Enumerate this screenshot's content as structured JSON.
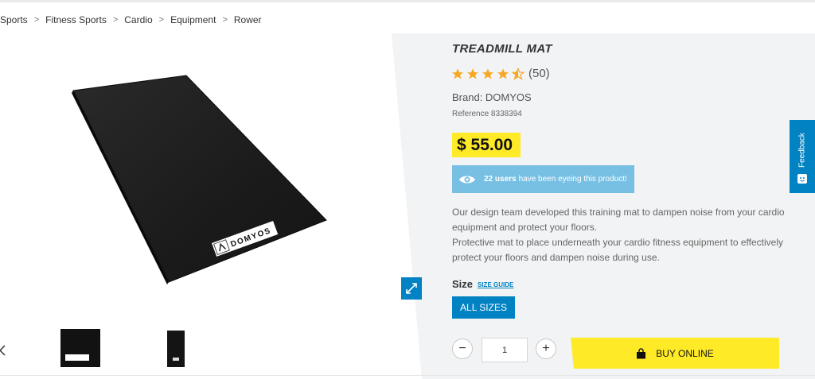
{
  "breadcrumb": {
    "items": [
      {
        "label": "Sports"
      },
      {
        "label": "Fitness Sports"
      },
      {
        "label": "Cardio"
      },
      {
        "label": "Equipment"
      },
      {
        "label": "Rower"
      }
    ],
    "separator": ">"
  },
  "product": {
    "title": "TREADMILL MAT",
    "rating": {
      "stars": 4.5,
      "max": 5,
      "count_label": "(50)"
    },
    "brand": "Brand: DOMYOS",
    "reference": "Reference 8338394",
    "price": "$ 55.00",
    "eyeing": {
      "count": "22 users",
      "text": "have been eyeing this product!"
    },
    "description": [
      "Our design team developed this training mat to dampen noise from your cardio equipment and protect your floors.",
      "Protective mat to place underneath your cardio fitness equipment to effectively protect your floors and dampen noise during use."
    ],
    "image_logo_text": "DOMYOS"
  },
  "size": {
    "label": "Size",
    "guide_label": "SIZE GUIDE",
    "selected": "ALL SIZES"
  },
  "purchase": {
    "quantity": "1",
    "minus_label": "−",
    "plus_label": "+",
    "buy_label": "BUY ONLINE"
  },
  "feedback": {
    "label": "Feedback"
  },
  "icons": {
    "star": "star-icon",
    "eye": "eye-icon",
    "zoom": "expand-icon",
    "bag": "shopping-bag-icon",
    "feedback": "feedback-smile-icon"
  },
  "colors": {
    "accent_blue": "#0082c3",
    "price_yellow": "#ffea28",
    "eyeing_bg": "#77c0e3",
    "star": "#f7a823",
    "panel_grey": "#f1f3f4"
  }
}
